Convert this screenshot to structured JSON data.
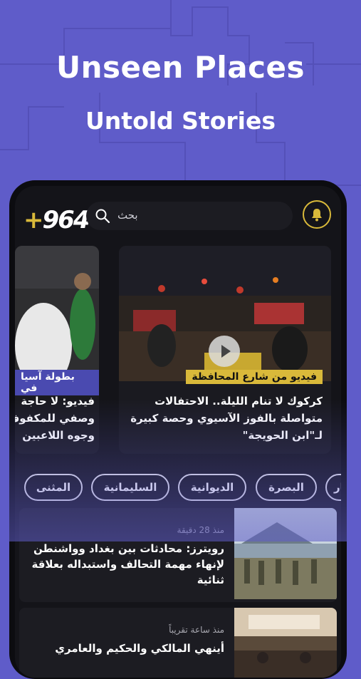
{
  "hero": {
    "title": "Unseen Places",
    "subtitle": "Untold Stories"
  },
  "header": {
    "logo_plus": "+",
    "logo_number": "964",
    "search_placeholder": "بحث"
  },
  "featured": [
    {
      "tag": "فيديو من شارع المحافظة",
      "text": "كركوك لا تنام الليلة.. الاحتفالات متواصلة بالفوز الآسيوي وحصة كبيرة لـ\"ابن الحويجة\""
    },
    {
      "tag": "بطولة آسيا في",
      "text_line1": "فيديو: لا حاجة",
      "text_line2": "وصفي للمكفوف",
      "text_line3": "وجوه اللاعبين"
    }
  ],
  "chips": [
    "الأنبار",
    "البصرة",
    "الديوانية",
    "السليمانية",
    "المثنى",
    ""
  ],
  "news": [
    {
      "time": "منذ 28 دقيقة",
      "headline": "رويترز: محادثات بين بغداد وواشنطن لإنهاء مهمة التحالف واستبداله بعلاقة ثنائية"
    },
    {
      "time": "منذ ساعة تقريباً",
      "headline": "أينهي المالكي والحكيم والعامري"
    }
  ],
  "colors": {
    "background": "#5f5cc9",
    "accent": "#d9b93a"
  }
}
